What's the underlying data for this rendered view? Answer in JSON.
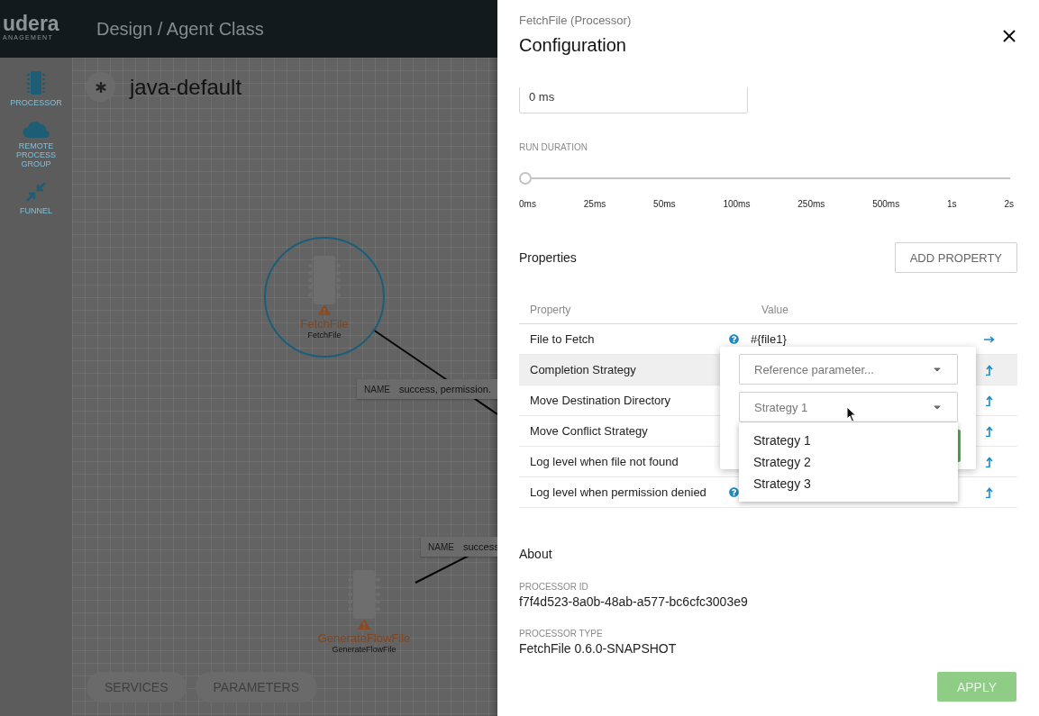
{
  "header": {
    "logo_text": "udera",
    "logo_subtext": "ANAGEMENT",
    "breadcrumb": "Design / Agent Class"
  },
  "palette": [
    {
      "label": "PROCESSOR",
      "kind": "processor"
    },
    {
      "label": "REMOTE PROCESS GROUP",
      "kind": "remote"
    },
    {
      "label": "FUNNEL",
      "kind": "funnel"
    }
  ],
  "flow": {
    "name": "java-default"
  },
  "nodes": [
    {
      "name": "FetchFile",
      "type": "FetchFile",
      "selected": true,
      "warning": true
    },
    {
      "name": "GenerateFlowFile",
      "type": "GenerateFlowFile",
      "selected": false,
      "warning": true
    }
  ],
  "connections": [
    {
      "label": "NAME",
      "value": "success, permission."
    },
    {
      "label": "NAME",
      "value": "success"
    }
  ],
  "canvas_buttons": [
    "SERVICES",
    "PARAMETERS"
  ],
  "panel": {
    "subtitle": "FetchFile (Processor)",
    "title": "Configuration",
    "field_value": "0 ms",
    "run_duration": {
      "label": "RUN DURATION",
      "level": 0,
      "ticks": [
        "0ms",
        "25ms",
        "50ms",
        "100ms",
        "250ms",
        "500ms",
        "1s",
        "2s"
      ]
    },
    "properties": {
      "title": "Properties",
      "add_button": "ADD PROPERTY",
      "columns": [
        "Property",
        "Value"
      ],
      "rows": [
        {
          "name": "File to Fetch",
          "help": true,
          "value": "#{file1}",
          "selected": false
        },
        {
          "name": "Completion Strategy",
          "help": false,
          "selected": true
        },
        {
          "name": "Move Destination Directory",
          "help": false,
          "selected": false
        },
        {
          "name": "Move Conflict Strategy",
          "help": false,
          "selected": false
        },
        {
          "name": "Log level when file not found",
          "help": false,
          "selected": false
        },
        {
          "name": "Log level when permission denied",
          "help": true,
          "selected": false
        }
      ]
    },
    "editor": {
      "parameter_select": {
        "placeholder": "Reference parameter..."
      },
      "value_select": {
        "value": "Strategy 1",
        "expanded": true
      },
      "options": [
        "Strategy 1",
        "Strategy 2",
        "Strategy 3"
      ]
    },
    "about": {
      "title": "About",
      "fields": [
        {
          "label": "PROCESSOR ID",
          "value": "f7f4d523-8a0b-48ab-a577-bc6cfc3003e9"
        },
        {
          "label": "PROCESSOR TYPE",
          "value": "FetchFile 0.6.0-SNAPSHOT"
        }
      ]
    },
    "apply_button": {
      "label": "APPLY",
      "disabled": true
    }
  }
}
